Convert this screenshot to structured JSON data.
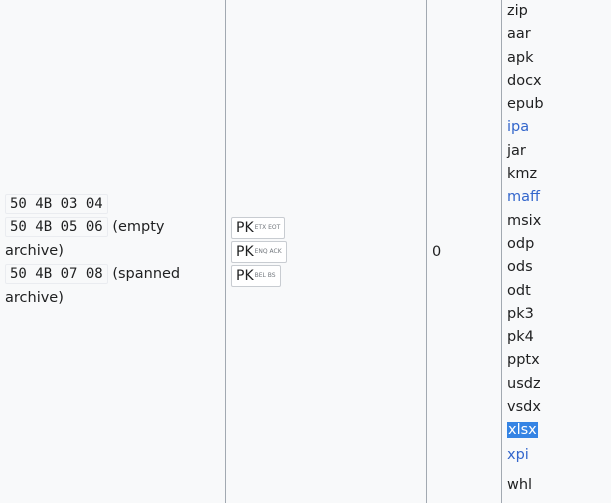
{
  "signatures": [
    {
      "hex": "50 4B 03 04",
      "note": ""
    },
    {
      "hex": "50 4B 05 06",
      "note": "(empty archive)"
    },
    {
      "hex": "50 4B 07 08",
      "note_a": "(spanned",
      "note_b": "archive)"
    }
  ],
  "iso_representations": [
    {
      "prefix": "PK",
      "ctrl": "ETX EOT"
    },
    {
      "prefix": "PK",
      "ctrl": "ENQ ACK"
    },
    {
      "prefix": "PK",
      "ctrl": "BEL BS"
    }
  ],
  "offset": "0",
  "extensions": [
    {
      "ext": "zip",
      "link": false
    },
    {
      "ext": "aar",
      "link": false
    },
    {
      "ext": "apk",
      "link": false
    },
    {
      "ext": "docx",
      "link": false
    },
    {
      "ext": "epub",
      "link": false
    },
    {
      "ext": "ipa",
      "link": true
    },
    {
      "ext": "jar",
      "link": false
    },
    {
      "ext": "kmz",
      "link": false
    },
    {
      "ext": "maff",
      "link": true
    },
    {
      "ext": "msix",
      "link": false
    },
    {
      "ext": "odp",
      "link": false
    },
    {
      "ext": "ods",
      "link": false
    },
    {
      "ext": "odt",
      "link": false
    },
    {
      "ext": "pk3",
      "link": false
    },
    {
      "ext": "pk4",
      "link": false
    },
    {
      "ext": "pptx",
      "link": false
    },
    {
      "ext": "usdz",
      "link": false
    },
    {
      "ext": "vsdx",
      "link": false
    },
    {
      "ext": "xlsx",
      "link": false,
      "selected": true
    },
    {
      "ext": "xpi",
      "link": true
    },
    {
      "ext": "whl",
      "link": false
    }
  ],
  "colors": {
    "link": "#3366cc",
    "selection": "#3584e4",
    "border": "#a2a9b1"
  }
}
